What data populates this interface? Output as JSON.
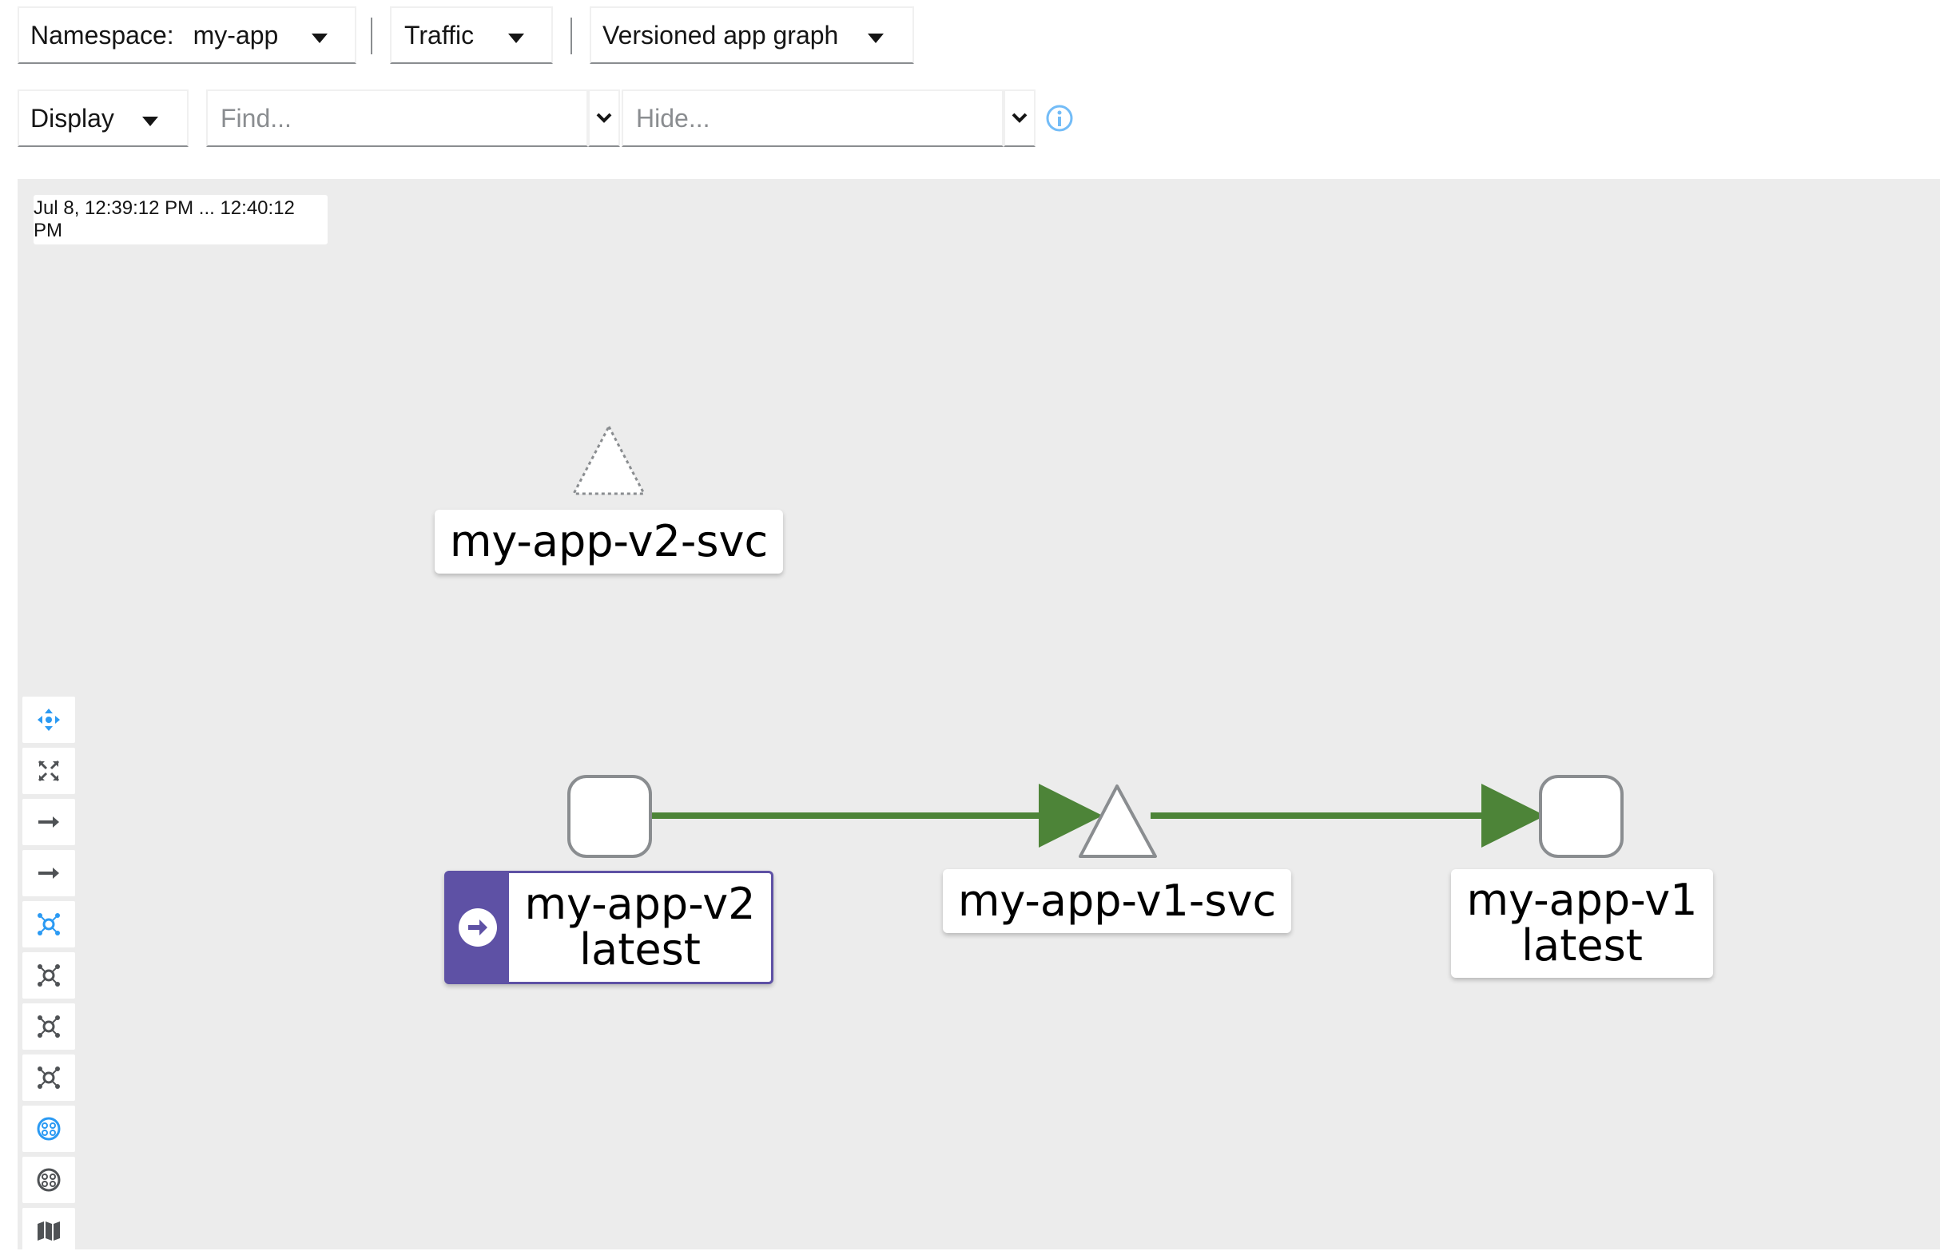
{
  "toolbar": {
    "namespace_label": "Namespace:",
    "namespace_value": "my-app",
    "traffic_label": "Traffic",
    "graph_type_label": "Versioned app graph",
    "display_label": "Display",
    "find_placeholder": "Find...",
    "hide_placeholder": "Hide..."
  },
  "graph": {
    "time_range": "Jul 8, 12:39:12 PM ... 12:40:12 PM",
    "nodes": {
      "svc_v2": "my-app-v2-svc",
      "app_v2_name": "my-app-v2",
      "app_v2_version": "latest",
      "svc_v1": "my-app-v1-svc",
      "app_v1_name": "my-app-v1",
      "app_v1_version": "latest"
    },
    "colors": {
      "edge": "#4d8438",
      "root_badge": "#5e51a5",
      "icon_blue": "#2b9af3",
      "icon_gray": "#4f5255",
      "info": "#73bcf7"
    }
  },
  "side_controls": [
    "pan-icon",
    "fit-to-screen-icon",
    "arrow-right-icon",
    "arrow-right-icon",
    "layout-default-icon",
    "layout-1-icon",
    "layout-2-icon",
    "layout-3-icon",
    "namespace-boxes-icon",
    "cluster-boxes-icon",
    "legend-map-icon"
  ]
}
